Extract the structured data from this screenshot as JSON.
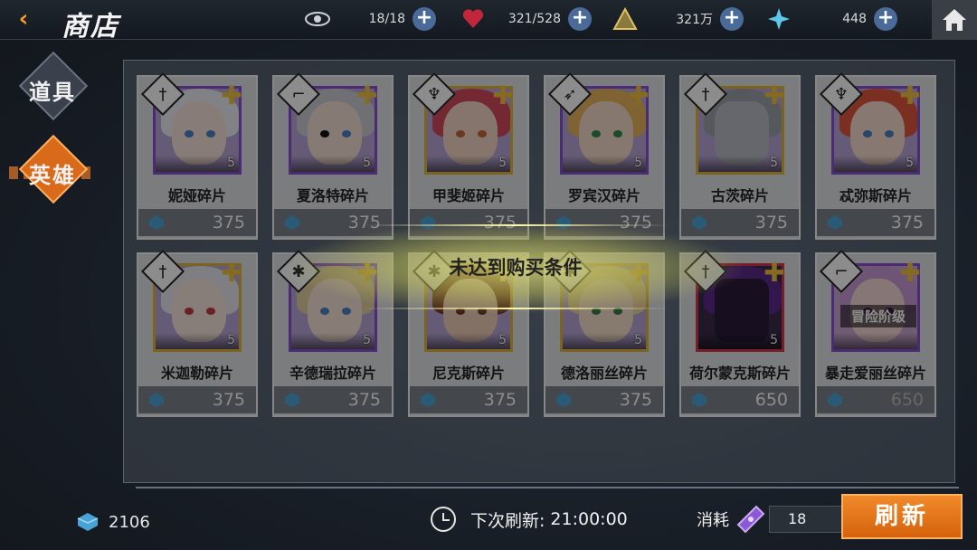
{
  "header": {
    "title": "商店",
    "resources": [
      {
        "icon": "eye-icon",
        "value": "18/18"
      },
      {
        "icon": "heart-icon",
        "value": "321/528"
      },
      {
        "icon": "pyramid-icon",
        "value": "321万"
      },
      {
        "icon": "star-crystal-icon",
        "value": "448"
      }
    ]
  },
  "tabs": {
    "items": "道具",
    "heroes": "英雄",
    "active": "heroes"
  },
  "cards": [
    {
      "name": "妮娅碎片",
      "price": "375",
      "class_icon": "sword-icon",
      "frame": "purple",
      "stars": "5"
    },
    {
      "name": "夏洛特碎片",
      "price": "375",
      "class_icon": "gun-icon",
      "frame": "purple",
      "stars": "5"
    },
    {
      "name": "甲斐姬碎片",
      "price": "375",
      "class_icon": "shield-wing-icon",
      "frame": "gold",
      "stars": "5"
    },
    {
      "name": "罗宾汉碎片",
      "price": "375",
      "class_icon": "bow-icon",
      "frame": "purple",
      "stars": "5"
    },
    {
      "name": "古茨碎片",
      "price": "375",
      "class_icon": "sword-icon",
      "frame": "gold",
      "stars": "5"
    },
    {
      "name": "忒弥斯碎片",
      "price": "375",
      "class_icon": "shield-wing-icon",
      "frame": "purple",
      "stars": "5"
    },
    {
      "name": "米迦勒碎片",
      "price": "375",
      "class_icon": "sword-icon",
      "frame": "gold",
      "stars": "5"
    },
    {
      "name": "辛德瑞拉碎片",
      "price": "375",
      "class_icon": "snowflake-icon",
      "frame": "purple",
      "stars": "5"
    },
    {
      "name": "尼克斯碎片",
      "price": "375",
      "class_icon": "snowflake-icon",
      "frame": "gold",
      "stars": "5"
    },
    {
      "name": "德洛丽丝碎片",
      "price": "375",
      "class_icon": "snowflake-icon",
      "frame": "gold",
      "stars": "5"
    },
    {
      "name": "荷尔蒙克斯碎片",
      "price": "650",
      "class_icon": "sword-icon",
      "frame": "red",
      "stars": "5"
    },
    {
      "name": "暴走爱丽丝碎片",
      "price": "650",
      "class_icon": "gun-icon",
      "frame": "purple",
      "stars": "",
      "locked_label": "冒险阶级"
    }
  ],
  "toast": {
    "message": "未达到购买条件"
  },
  "footer": {
    "wallet": "2106",
    "refresh_label": "下次刷新:",
    "refresh_time": "21:00:00",
    "cost_label": "消耗",
    "cost_count": "18",
    "refresh_button": "刷新"
  },
  "colors": {
    "accent_orange": "#e0782a",
    "frame_purple": "#8a4fd6",
    "frame_gold": "#e0b43a",
    "frame_red": "#d8334a"
  }
}
